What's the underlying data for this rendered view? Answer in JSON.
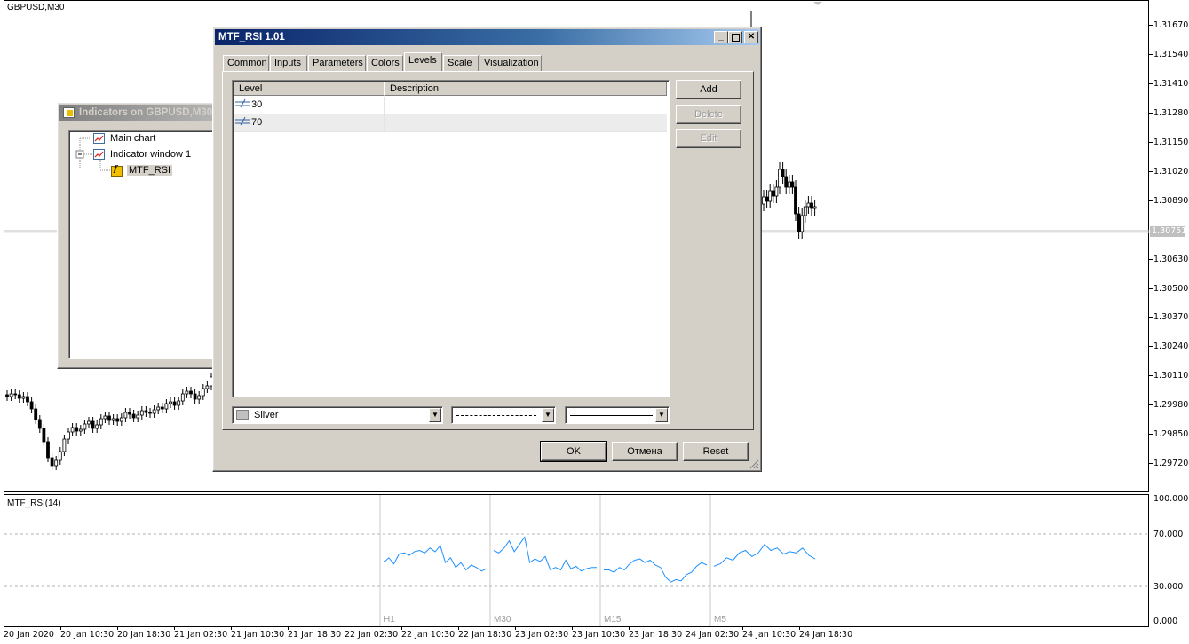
{
  "chart": {
    "symbol": "GBPUSD,M30",
    "current_price": "1.30751",
    "price_axis": [
      "1.31670",
      "1.31540",
      "1.31410",
      "1.31280",
      "1.31150",
      "1.31020",
      "1.30890",
      "1.30630",
      "1.30500",
      "1.30370",
      "1.30240",
      "1.30110",
      "1.29980",
      "1.29850",
      "1.29720"
    ],
    "time_axis": [
      "20 Jan 2020",
      "20 Jan 10:30",
      "20 Jan 18:30",
      "21 Jan 02:30",
      "21 Jan 10:30",
      "21 Jan 18:30",
      "22 Jan 02:30",
      "22 Jan 10:30",
      "22 Jan 18:30",
      "23 Jan 02:30",
      "23 Jan 10:30",
      "23 Jan 18:30",
      "24 Jan 02:30",
      "24 Jan 10:30",
      "24 Jan 18:30"
    ]
  },
  "indicator_window": {
    "name": "MTF_RSI(14)",
    "scale": [
      "100.000",
      "70.000",
      "30.000",
      "0.000"
    ],
    "segments": [
      "H1",
      "M30",
      "M15",
      "M5"
    ]
  },
  "indicators_dialog": {
    "title": "Indicators on GBPUSD,M30",
    "tree": [
      {
        "label": "Main chart"
      },
      {
        "label": "Indicator window 1"
      },
      {
        "label": "MTF_RSI"
      }
    ]
  },
  "props_dialog": {
    "title": "MTF_RSI 1.01",
    "tabs": [
      "Common",
      "Inputs",
      "Parameters",
      "Colors",
      "Levels",
      "Scale",
      "Visualization"
    ],
    "active_tab": "Levels",
    "table": {
      "columns": [
        "Level",
        "Description"
      ],
      "rows": [
        {
          "level": "30",
          "description": ""
        },
        {
          "level": "70",
          "description": ""
        }
      ]
    },
    "side_buttons": {
      "add": "Add",
      "delete": "Delete",
      "edit": "Edit"
    },
    "color_select": {
      "value": "Silver",
      "swatch": "#c0c0c0"
    },
    "style_select": {
      "value": "dashed"
    },
    "width_select": {
      "value": "solid"
    },
    "footer_buttons": {
      "ok": "OK",
      "cancel": "Отмена",
      "reset": "Reset"
    }
  },
  "rsi_series": {
    "color": "#1e90ff",
    "H1": [
      48,
      52,
      47,
      55,
      56,
      54,
      57,
      58,
      56,
      60,
      57,
      62,
      48,
      52,
      44,
      48,
      42,
      46,
      44,
      41,
      43
    ],
    "M30": [
      58,
      56,
      60,
      66,
      57,
      63,
      69,
      48,
      51,
      49,
      53,
      42,
      44,
      42,
      50,
      43,
      45,
      41,
      43,
      44,
      44
    ],
    "M15": [
      42,
      42,
      40,
      44,
      42,
      47,
      50,
      51,
      48,
      50,
      46,
      44,
      36,
      32,
      34,
      33,
      38,
      40,
      45,
      48,
      46
    ],
    "M5": [
      45,
      47,
      52,
      50,
      56,
      58,
      53,
      56,
      63,
      58,
      60,
      55,
      57,
      56,
      60,
      54,
      51
    ],
    "levels": [
      30,
      70
    ]
  }
}
